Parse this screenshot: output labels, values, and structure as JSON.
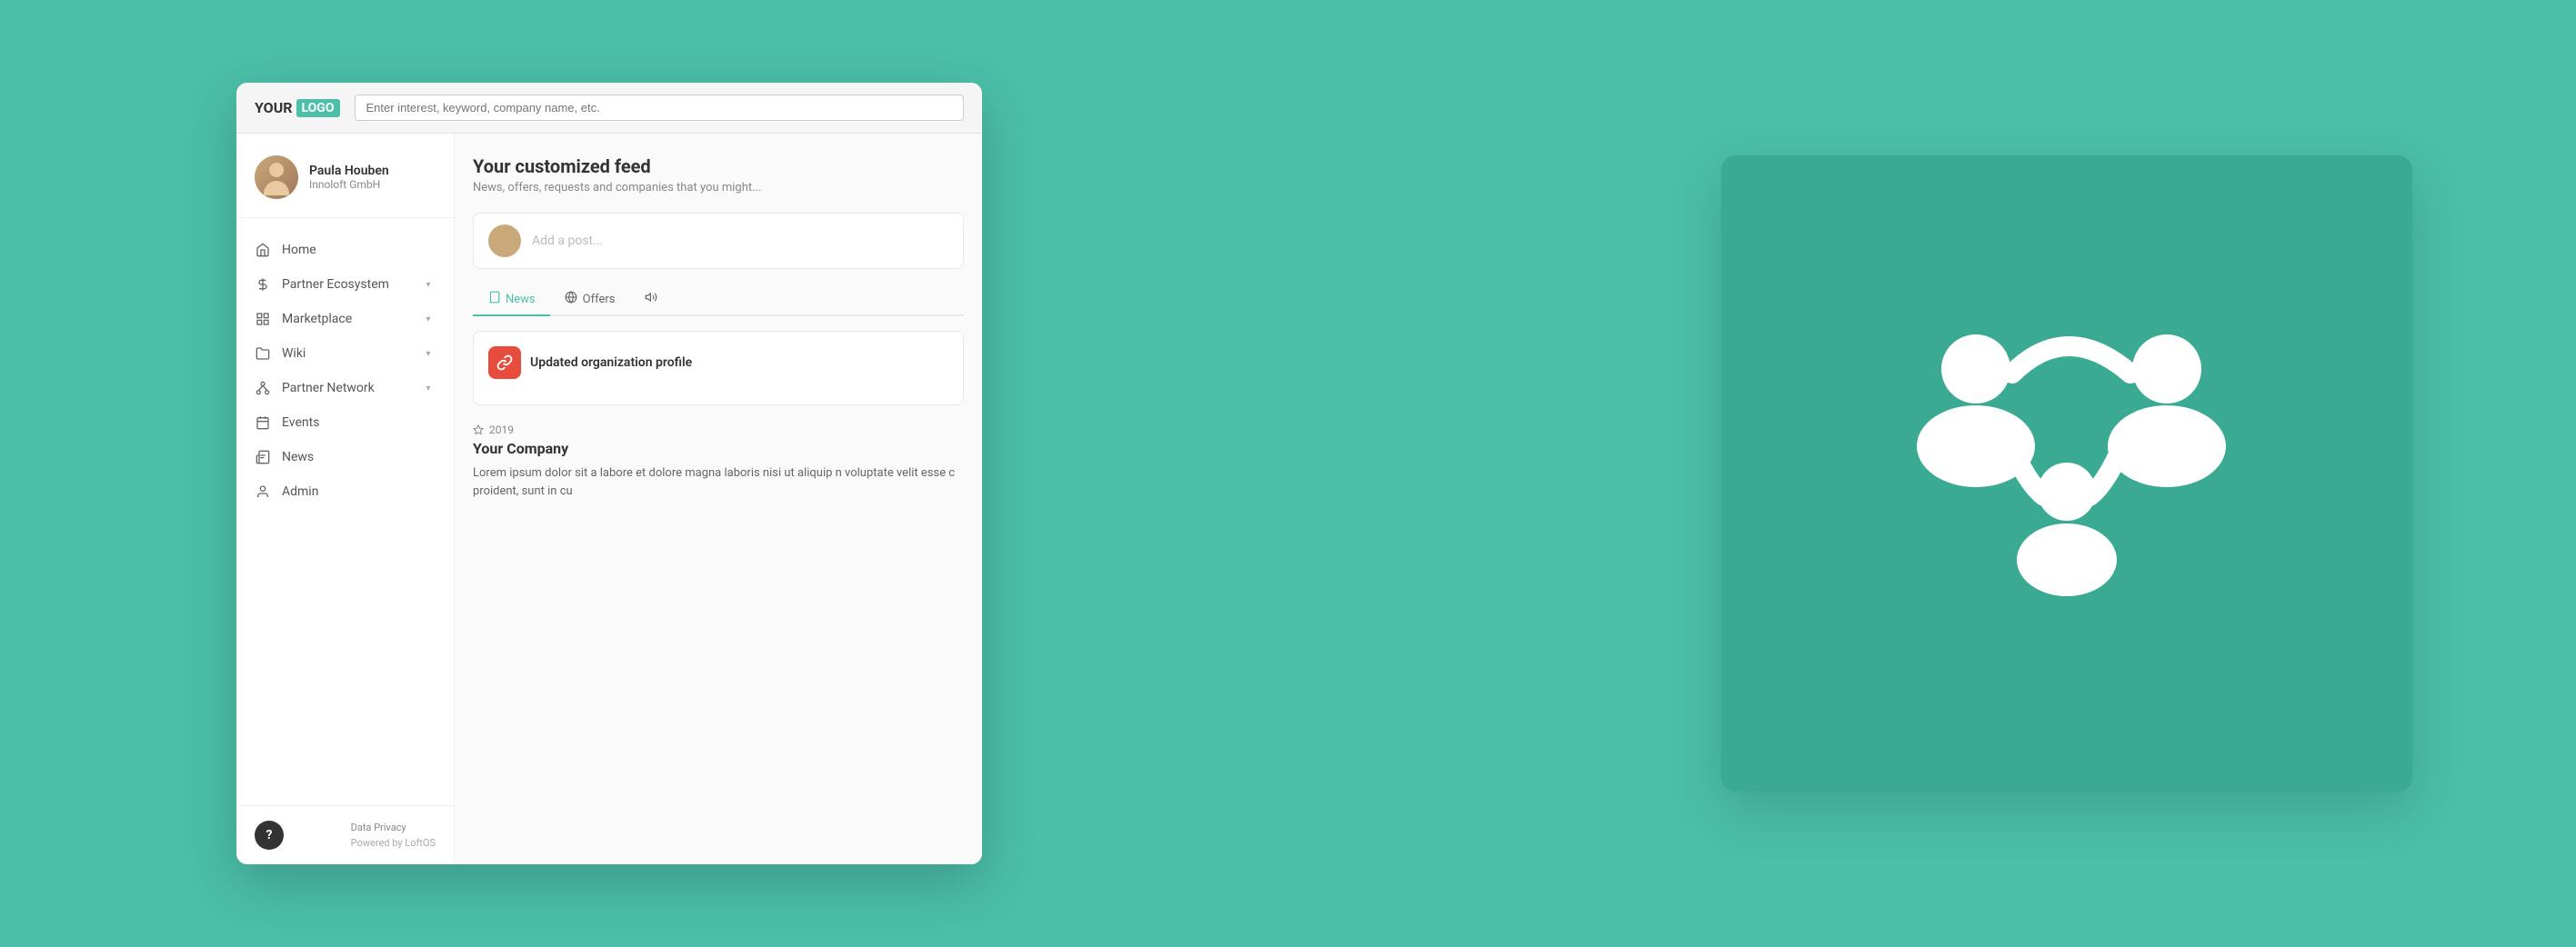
{
  "logo": {
    "your": "YOUR",
    "logo": "LOGO"
  },
  "search": {
    "placeholder": "Enter interest, keyword, company name, etc."
  },
  "user": {
    "name": "Paula Houben",
    "company": "Innoloft GmbH"
  },
  "nav": {
    "items": [
      {
        "id": "home",
        "label": "Home",
        "icon": "home",
        "hasChevron": false
      },
      {
        "id": "partner-ecosystem",
        "label": "Partner Ecosystem",
        "icon": "asterisk",
        "hasChevron": true
      },
      {
        "id": "marketplace",
        "label": "Marketplace",
        "icon": "grid",
        "hasChevron": true
      },
      {
        "id": "wiki",
        "label": "Wiki",
        "icon": "bookmark",
        "hasChevron": true
      },
      {
        "id": "partner-network",
        "label": "Partner Network",
        "icon": "network",
        "hasChevron": true
      },
      {
        "id": "events",
        "label": "Events",
        "icon": "calendar",
        "hasChevron": false
      },
      {
        "id": "news",
        "label": "News",
        "icon": "news",
        "hasChevron": false
      },
      {
        "id": "admin",
        "label": "Admin",
        "icon": "admin",
        "hasChevron": false
      }
    ]
  },
  "footer": {
    "data_privacy": "Data Privacy",
    "powered_by": "Powered by LoftOS",
    "help_label": "?"
  },
  "feed": {
    "title": "Your customized feed",
    "subtitle": "News, offers, requests and companies that you might...",
    "post_placeholder": "Add a post...",
    "tabs": [
      {
        "id": "news",
        "label": "News",
        "active": true
      },
      {
        "id": "offers",
        "label": "Offers",
        "active": false
      }
    ],
    "card": {
      "icon": "🔗",
      "title": "Updated organization profile"
    },
    "company": {
      "year": "2019",
      "name": "Your Company",
      "description": "Lorem ipsum dolor sit a labore et dolore magna laboris nisi ut aliquip n voluptate velit esse c proident, sunt in cu"
    }
  }
}
